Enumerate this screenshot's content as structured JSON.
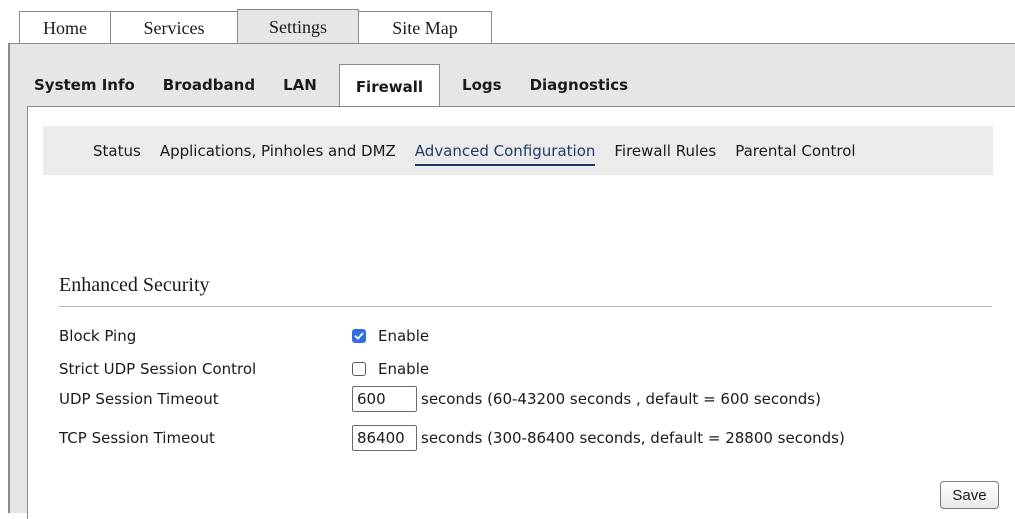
{
  "top_tabs": [
    {
      "label": "Home",
      "active": false
    },
    {
      "label": "Services",
      "active": false
    },
    {
      "label": "Settings",
      "active": true
    },
    {
      "label": "Site Map",
      "active": false
    }
  ],
  "sub_tabs": [
    {
      "label": "System Info",
      "active": false
    },
    {
      "label": "Broadband",
      "active": false
    },
    {
      "label": "LAN",
      "active": false
    },
    {
      "label": "Firewall",
      "active": true
    },
    {
      "label": "Logs",
      "active": false
    },
    {
      "label": "Diagnostics",
      "active": false
    }
  ],
  "pills": [
    {
      "label": "Status",
      "active": false
    },
    {
      "label": "Applications, Pinholes and DMZ",
      "active": false
    },
    {
      "label": "Advanced Configuration",
      "active": true
    },
    {
      "label": "Firewall Rules",
      "active": false
    },
    {
      "label": "Parental Control",
      "active": false
    }
  ],
  "section": {
    "title": "Enhanced Security"
  },
  "fields": {
    "block_ping": {
      "label": "Block Ping",
      "checked": true,
      "option_label": "Enable"
    },
    "strict_udp": {
      "label": "Strict UDP Session Control",
      "checked": false,
      "option_label": "Enable"
    },
    "udp_timeout": {
      "label": "UDP Session Timeout",
      "value": "600",
      "hint": "seconds (60-43200 seconds , default = 600 seconds)"
    },
    "tcp_timeout": {
      "label": "TCP Session Timeout",
      "value": "86400",
      "hint": "seconds (300-86400 seconds, default = 28800 seconds)"
    }
  },
  "actions": {
    "save_label": "Save"
  },
  "colors": {
    "checkbox_checked": "#2f6fe0",
    "active_link": "#203a66",
    "panel_bg": "#e6e6e6"
  }
}
